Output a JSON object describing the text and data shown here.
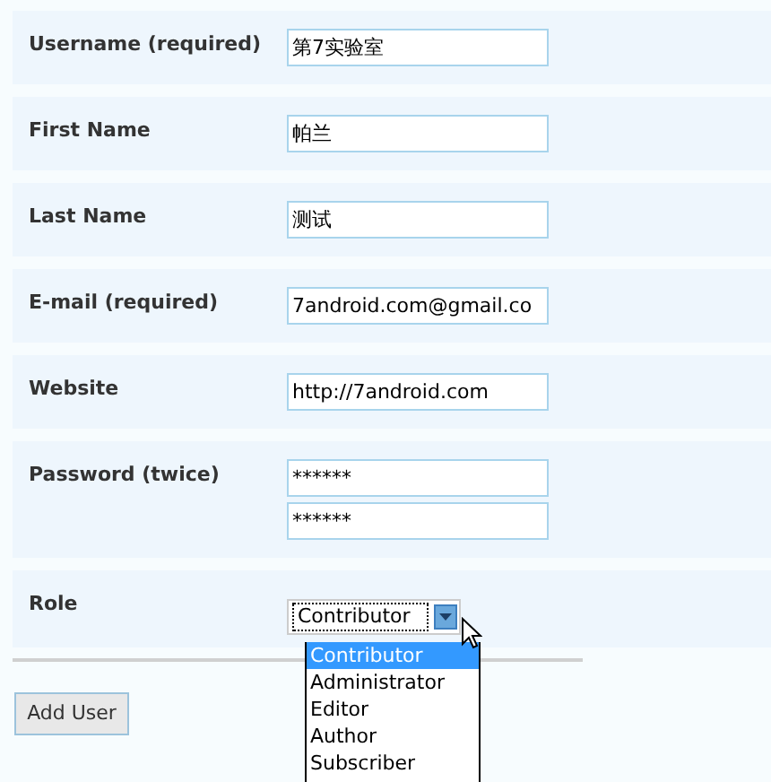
{
  "fields": [
    {
      "label": "Username (required)",
      "values": [
        "第7实验室"
      ]
    },
    {
      "label": "First Name",
      "values": [
        "帕兰"
      ]
    },
    {
      "label": "Last Name",
      "values": [
        "测试"
      ]
    },
    {
      "label": "E-mail (required)",
      "values": [
        "7android.com@gmail.co"
      ]
    },
    {
      "label": "Website",
      "values": [
        "http://7android.com"
      ]
    },
    {
      "label": "Password (twice)",
      "values": [
        "******",
        "******"
      ]
    }
  ],
  "role": {
    "label": "Role",
    "value": "Contributor",
    "expanded": true,
    "options": [
      {
        "label": "Contributor",
        "selected": true
      },
      {
        "label": "Administrator",
        "selected": false
      },
      {
        "label": "Editor",
        "selected": false
      },
      {
        "label": "Author",
        "selected": false
      },
      {
        "label": "Subscriber",
        "selected": false
      }
    ]
  },
  "submit": "Add User"
}
